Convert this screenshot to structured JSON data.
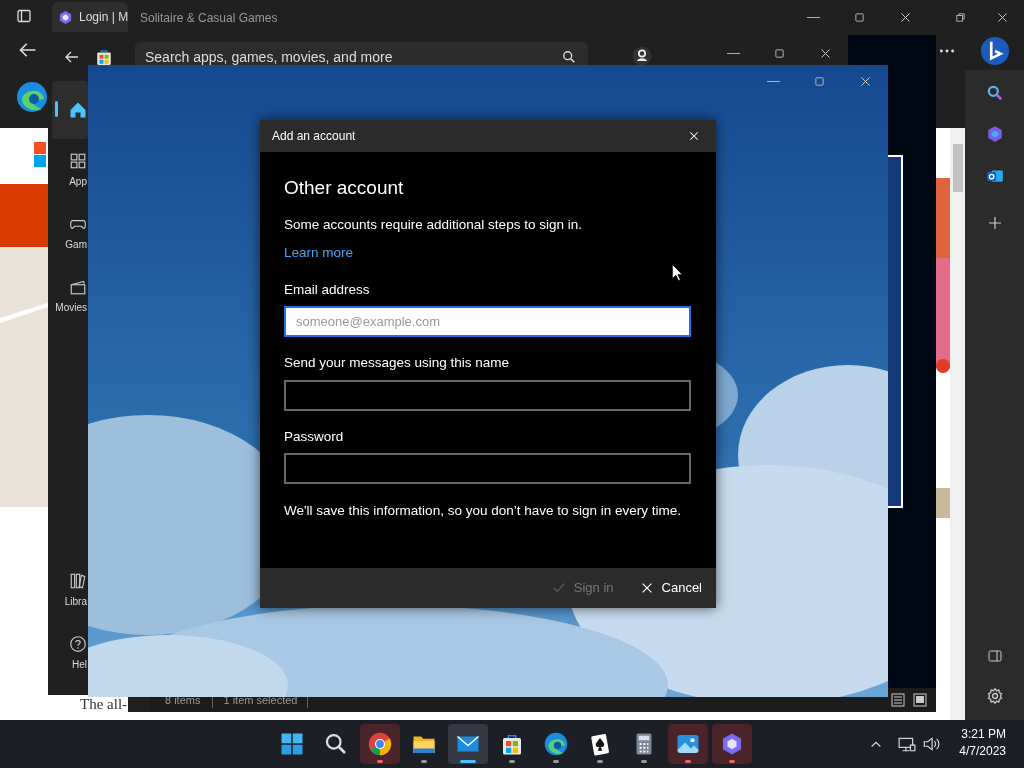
{
  "browser": {
    "tab_title": "Login | M",
    "page_text": "The all-"
  },
  "solitaire_window": {
    "title": "Solitaire & Casual Games"
  },
  "explorer_status": {
    "items": "8 items",
    "selected": "1 item selected"
  },
  "store_window": {
    "search": {
      "placeholder": "Search apps, games, movies, and more"
    },
    "nav": [
      {
        "kind": "home",
        "selected": true
      },
      {
        "kind": "apps",
        "label": "App",
        "selected": false
      },
      {
        "kind": "gaming",
        "label": "Gam",
        "selected": false
      },
      {
        "kind": "movies",
        "label": "Movies",
        "selected": false
      },
      {
        "kind": "library",
        "label": "Libra",
        "selected": false
      },
      {
        "kind": "help",
        "label": "Hel",
        "selected": false
      }
    ]
  },
  "dialog": {
    "title": "Add an account",
    "heading": "Other account",
    "intro": "Some accounts require additional steps to sign in.",
    "link": "Learn more",
    "fields": [
      {
        "label": "Email address",
        "placeholder": "someone@example.com",
        "focused": true
      },
      {
        "label": "Send your messages using this name",
        "focused": false
      },
      {
        "label": "Password",
        "focused": false
      }
    ],
    "note": "We'll save this information, so you don’t have to sign in every time.",
    "buttons": [
      {
        "kind": "confirm",
        "label": "Sign in",
        "disabled": true
      },
      {
        "kind": "cancel",
        "label": "Cancel",
        "disabled": false
      }
    ]
  },
  "taskbar": {
    "apps": [
      {
        "kind": "start",
        "running": false,
        "active": false,
        "flashing": false
      },
      {
        "kind": "search",
        "running": false,
        "active": false,
        "flashing": false
      },
      {
        "kind": "chrome",
        "running": true,
        "active": false,
        "flashing": true
      },
      {
        "kind": "files",
        "running": true,
        "active": false,
        "flashing": false
      },
      {
        "kind": "mail",
        "running": true,
        "active": true,
        "flashing": false
      },
      {
        "kind": "store",
        "running": true,
        "active": false,
        "flashing": false
      },
      {
        "kind": "edge",
        "running": true,
        "active": false,
        "flashing": false
      },
      {
        "kind": "solitaire",
        "running": true,
        "active": false,
        "flashing": false
      },
      {
        "kind": "calculator",
        "running": true,
        "active": false,
        "flashing": false
      },
      {
        "kind": "photos",
        "running": true,
        "active": false,
        "flashing": true
      },
      {
        "kind": "clipchamp",
        "running": true,
        "active": false,
        "flashing": true
      }
    ],
    "time": "3:21 PM",
    "date": "4/7/2023"
  }
}
